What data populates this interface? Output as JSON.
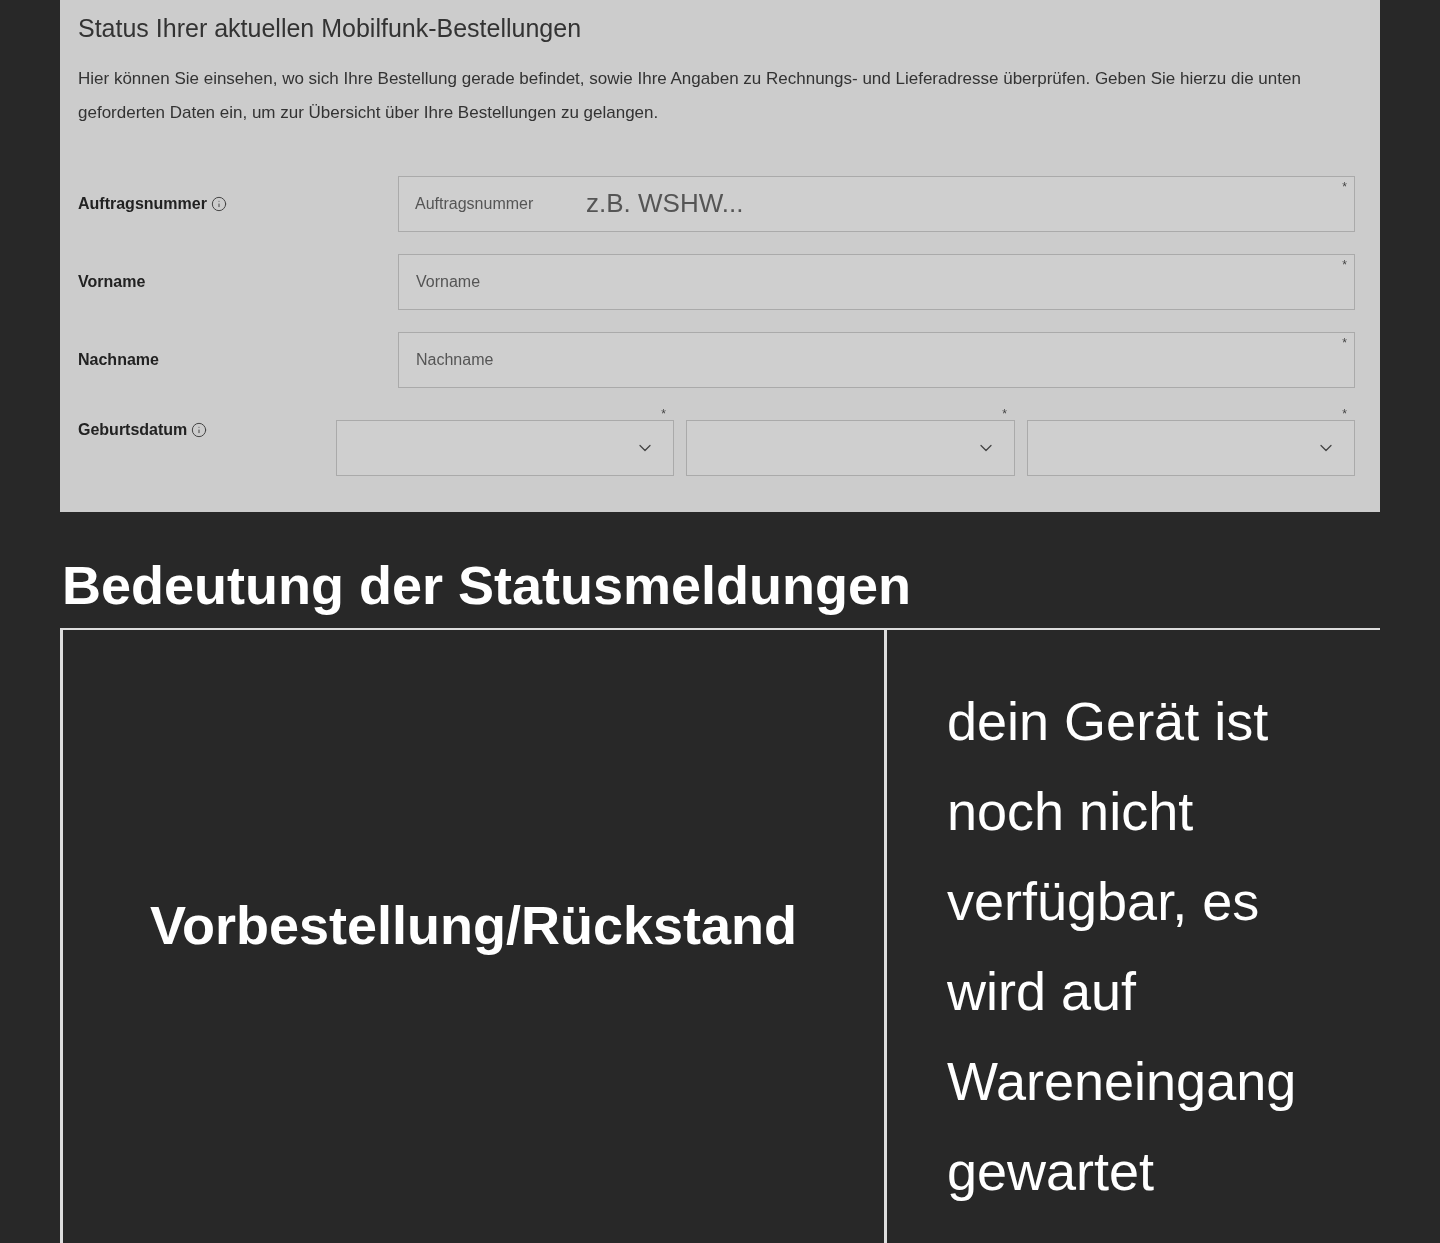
{
  "form": {
    "title": "Status Ihrer aktuellen Mobilfunk-Bestellungen",
    "intro": "Hier können Sie einsehen, wo sich Ihre Bestellung gerade befindet, sowie Ihre Angaben zu Rechnungs- und Lieferadresse überprüfen. Geben Sie hierzu die unten geforderten Daten ein, um zur Übersicht über Ihre Bestellungen zu gelangen.",
    "fields": [
      {
        "kind": "text",
        "label": "Auftragsnummer",
        "info": true,
        "inner_label": "Auftragsnummer",
        "placeholder": "z.B. WSHW...",
        "required_mark": "*"
      },
      {
        "kind": "text",
        "label": "Vorname",
        "info": false,
        "placeholder": "Vorname",
        "required_mark": "*"
      },
      {
        "kind": "text",
        "label": "Nachname",
        "info": false,
        "placeholder": "Nachname",
        "required_mark": "*"
      },
      {
        "kind": "date",
        "label": "Geburtsdatum",
        "info": true,
        "required_marks": [
          "*",
          "*",
          "*"
        ]
      }
    ]
  },
  "legend": {
    "title": "Bedeutung der Statusmeldungen",
    "rows": [
      {
        "status": "Vorbestellung/Rückstand",
        "meaning": "dein Gerät ist noch nicht verfügbar, es wird auf Wareneingang gewartet"
      }
    ]
  }
}
